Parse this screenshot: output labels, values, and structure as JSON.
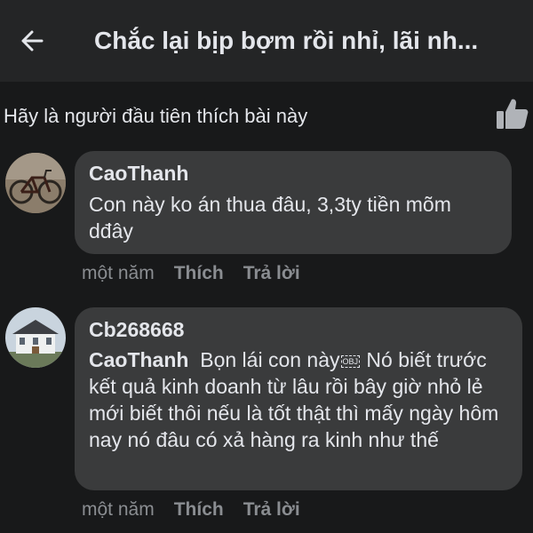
{
  "header": {
    "title": "Chắc lại bịp bợm rồi nhỉ, lãi nh..."
  },
  "likes": {
    "prompt": "Hãy là người đầu tiên thích bài này"
  },
  "comments": [
    {
      "author": "CaoThanh",
      "text": "Con này ko án thua đâu, 3,3ty tiền mõm dđây",
      "time": "một năm",
      "like_label": "Thích",
      "reply_label": "Trả lời"
    },
    {
      "author": "Cb268668",
      "mention": "CaoThanh",
      "text_before_obj": "Bọn lái con này",
      "obj_glyph": "OBJ",
      "text_after_obj": " Nó biết trước kết quả kinh doanh từ lâu rồi bây giờ nhỏ lẻ mới biết thôi nếu là tốt thật thì mấy ngày hôm nay nó đâu có xả hàng ra kinh như thế",
      "time": "một năm",
      "like_label": "Thích",
      "reply_label": "Trả lời"
    }
  ],
  "colors": {
    "background": "#18191a",
    "header": "#242526",
    "bubble": "#3a3b3c",
    "meta": "#8a8d91"
  }
}
